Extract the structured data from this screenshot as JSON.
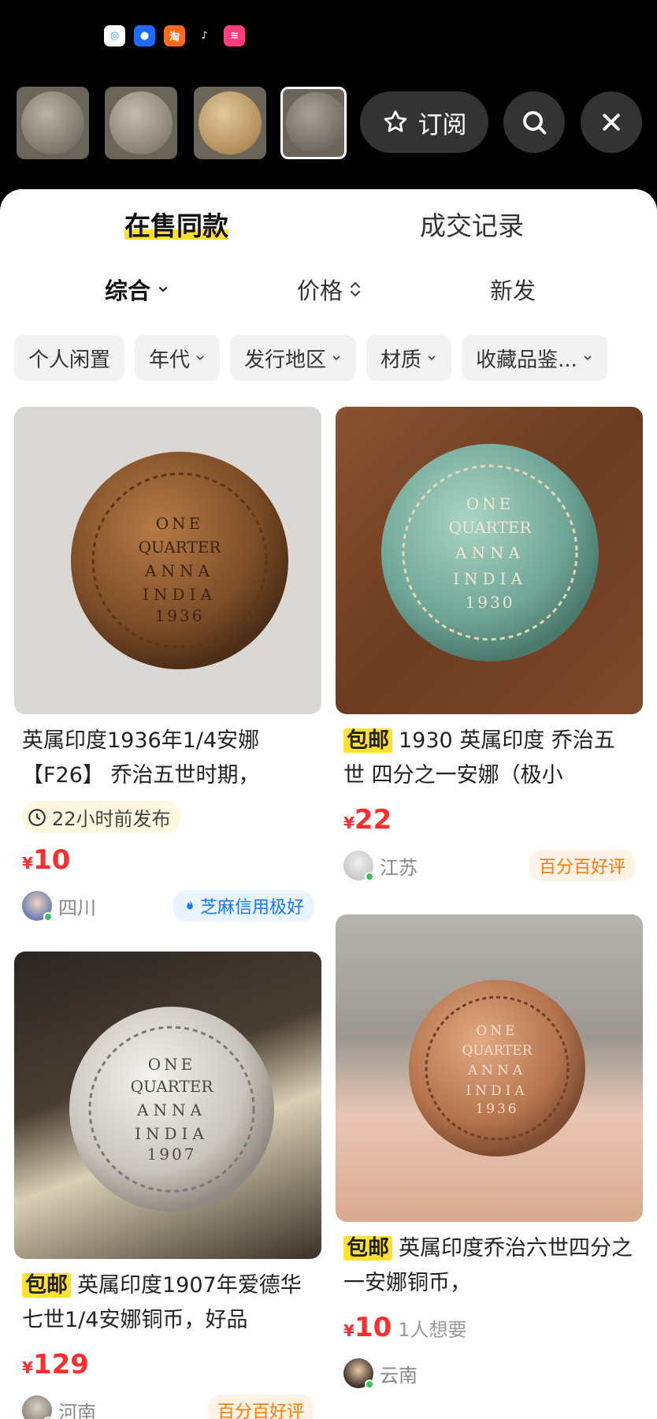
{
  "status_bar": {
    "app_icons": [
      {
        "name": "message-app-icon",
        "color": "#ffffff",
        "glyph": "◎"
      },
      {
        "name": "assistant-app-icon",
        "color": "#1e6bff",
        "glyph": "●"
      },
      {
        "name": "taobao-app-icon",
        "color": "#ff6a1a",
        "glyph": "淘"
      },
      {
        "name": "tiktok-app-icon",
        "color": "#000000",
        "glyph": "♪"
      },
      {
        "name": "chat-app-icon",
        "color": "#ff3d7f",
        "glyph": "≋"
      }
    ]
  },
  "top_bar": {
    "subscribe_label": "订阅"
  },
  "tabs": [
    {
      "label": "在售同款",
      "active": true
    },
    {
      "label": "成交记录",
      "active": false
    }
  ],
  "sort": {
    "comprehensive": "综合",
    "price": "价格",
    "newest": "新发"
  },
  "filters": [
    "个人闲置",
    "年代",
    "发行地区",
    "材质",
    "收藏品鉴..."
  ],
  "products": [
    {
      "title": "英属印度1936年1/4安娜【F26】 乔治五世时期，",
      "baoyou": false,
      "time": "22小时前发布",
      "currency": "¥",
      "price": "10",
      "wants": "",
      "location": "四川",
      "badge": "芝麻信用极好",
      "badge_style": "blue",
      "coin_text": "ONE QUARTER ANNA INDIA 1936"
    },
    {
      "title": "1930 英属印度 乔治五世 四分之一安娜（极小",
      "baoyou": true,
      "baoyou_label": "包邮",
      "time": "",
      "currency": "¥",
      "price": "22",
      "wants": "",
      "location": "江苏",
      "badge": "百分百好评",
      "badge_style": "orange",
      "coin_text": "ONE QUARTER ANNA INDIA 1930"
    },
    {
      "title": "英属印度1907年爱德华七世1/4安娜铜币，好品",
      "baoyou": true,
      "baoyou_label": "包邮",
      "time": "",
      "currency": "¥",
      "price": "129",
      "wants": "",
      "location": "河南",
      "badge": "百分百好评",
      "badge_style": "orange",
      "coin_text": "ONE QUARTER ANNA INDIA 1907"
    },
    {
      "title": "英属印度乔治六世四分之一安娜铜币，",
      "baoyou": true,
      "baoyou_label": "包邮",
      "time": "",
      "currency": "¥",
      "price": "10",
      "wants": "1人想要",
      "location": "云南",
      "badge": "",
      "badge_style": "",
      "coin_text": "ONE QUARTER ANNA INDIA 1936"
    }
  ],
  "colors": {
    "accent_yellow": "#ffe033",
    "price_red": "#ff2d2d",
    "credit_blue": "#1677ff",
    "rating_orange": "#ff7a00"
  }
}
